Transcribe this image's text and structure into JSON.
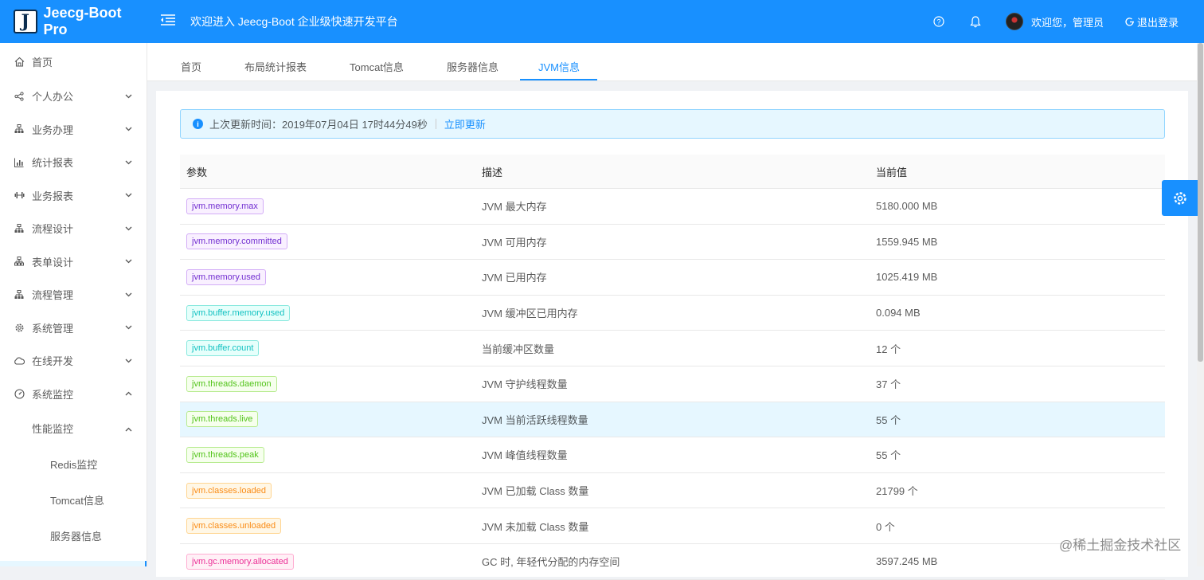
{
  "header": {
    "app_name": "Jeecg-Boot Pro",
    "logo_letter": "J",
    "welcome_title": "欢迎进入 Jeecg-Boot 企业级快速开发平台",
    "user_greeting": "欢迎您，管理员",
    "logout_label": "退出登录"
  },
  "sidebar": {
    "home": "首页",
    "items": [
      {
        "label": "个人办公",
        "icon": "share-icon"
      },
      {
        "label": "业务办理",
        "icon": "org-icon"
      },
      {
        "label": "统计报表",
        "icon": "bar-chart-icon"
      },
      {
        "label": "业务报表",
        "icon": "dumbbell-icon"
      },
      {
        "label": "流程设计",
        "icon": "org-icon"
      },
      {
        "label": "表单设计",
        "icon": "org-icon"
      },
      {
        "label": "流程管理",
        "icon": "org-icon"
      },
      {
        "label": "系统管理",
        "icon": "gear-icon"
      },
      {
        "label": "在线开发",
        "icon": "cloud-icon"
      }
    ],
    "monitor": "系统监控",
    "perf": "性能监控",
    "subs": [
      "Redis监控",
      "Tomcat信息",
      "服务器信息"
    ]
  },
  "tabs": [
    "首页",
    "布局统计报表",
    "Tomcat信息",
    "服务器信息",
    "JVM信息"
  ],
  "active_tab": "JVM信息",
  "alert": {
    "text": "上次更新时间：2019年07月04日 17时44分49秒",
    "refresh_label": "立即更新"
  },
  "table": {
    "headers": [
      "参数",
      "描述",
      "当前值"
    ],
    "rows": [
      {
        "param": "jvm.memory.max",
        "desc": "JVM 最大内存",
        "value": "5180.000 MB",
        "color": "#722ed1",
        "bg": "#f9f0ff",
        "border": "#d3adf7"
      },
      {
        "param": "jvm.memory.committed",
        "desc": "JVM 可用内存",
        "value": "1559.945 MB",
        "color": "#722ed1",
        "bg": "#f9f0ff",
        "border": "#d3adf7"
      },
      {
        "param": "jvm.memory.used",
        "desc": "JVM 已用内存",
        "value": "1025.419 MB",
        "color": "#722ed1",
        "bg": "#f9f0ff",
        "border": "#d3adf7"
      },
      {
        "param": "jvm.buffer.memory.used",
        "desc": "JVM 缓冲区已用内存",
        "value": "0.094 MB",
        "color": "#13c2c2",
        "bg": "#e6fffb",
        "border": "#87e8de"
      },
      {
        "param": "jvm.buffer.count",
        "desc": "当前缓冲区数量",
        "value": "12 个",
        "color": "#13c2c2",
        "bg": "#e6fffb",
        "border": "#87e8de"
      },
      {
        "param": "jvm.threads.daemon",
        "desc": "JVM 守护线程数量",
        "value": "37 个",
        "color": "#52c41a",
        "bg": "#f6ffed",
        "border": "#b7eb8f"
      },
      {
        "param": "jvm.threads.live",
        "desc": "JVM 当前活跃线程数量",
        "value": "55 个",
        "color": "#52c41a",
        "bg": "#f6ffed",
        "border": "#b7eb8f"
      },
      {
        "param": "jvm.threads.peak",
        "desc": "JVM 峰值线程数量",
        "value": "55 个",
        "color": "#52c41a",
        "bg": "#f6ffed",
        "border": "#b7eb8f"
      },
      {
        "param": "jvm.classes.loaded",
        "desc": "JVM 已加载 Class 数量",
        "value": "21799 个",
        "color": "#fa8c16",
        "bg": "#fff7e6",
        "border": "#ffd591"
      },
      {
        "param": "jvm.classes.unloaded",
        "desc": "JVM 未加载 Class 数量",
        "value": "0 个",
        "color": "#fa8c16",
        "bg": "#fff7e6",
        "border": "#ffd591"
      },
      {
        "param": "jvm.gc.memory.allocated",
        "desc": "GC 时, 年轻代分配的内存空间",
        "value": "3597.245 MB",
        "color": "#eb2f96",
        "bg": "#fff0f6",
        "border": "#ffadd2"
      }
    ]
  },
  "watermark": "@稀土掘金技术社区"
}
